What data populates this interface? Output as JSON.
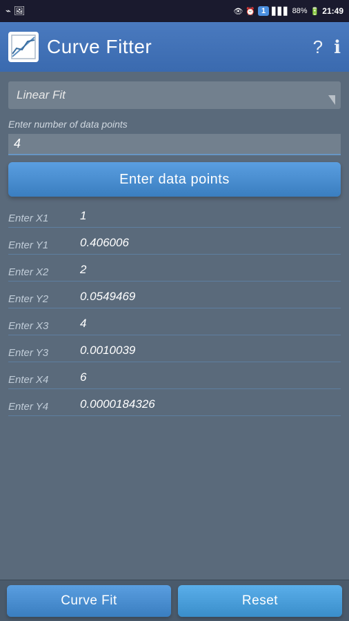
{
  "statusBar": {
    "time": "21:49",
    "battery": "88%"
  },
  "appBar": {
    "title": "Curve Fitter",
    "helpLabel": "?",
    "infoLabel": "ℹ"
  },
  "fitType": {
    "label": "Linear Fit"
  },
  "dataPointsSection": {
    "sectionLabel": "Enter number of data points",
    "numPoints": "4",
    "enterBtnLabel": "Enter data points"
  },
  "fields": [
    {
      "label": "Enter X1",
      "value": "1"
    },
    {
      "label": "Enter Y1",
      "value": "0.406006"
    },
    {
      "label": "Enter X2",
      "value": "2"
    },
    {
      "label": "Enter Y2",
      "value": "0.0549469"
    },
    {
      "label": "Enter X3",
      "value": "4"
    },
    {
      "label": "Enter Y3",
      "value": "0.0010039"
    },
    {
      "label": "Enter X4",
      "value": "6"
    },
    {
      "label": "Enter Y4",
      "value": "0.0000184326"
    }
  ],
  "bottomBar": {
    "curveFitLabel": "Curve Fit",
    "resetLabel": "Reset"
  }
}
